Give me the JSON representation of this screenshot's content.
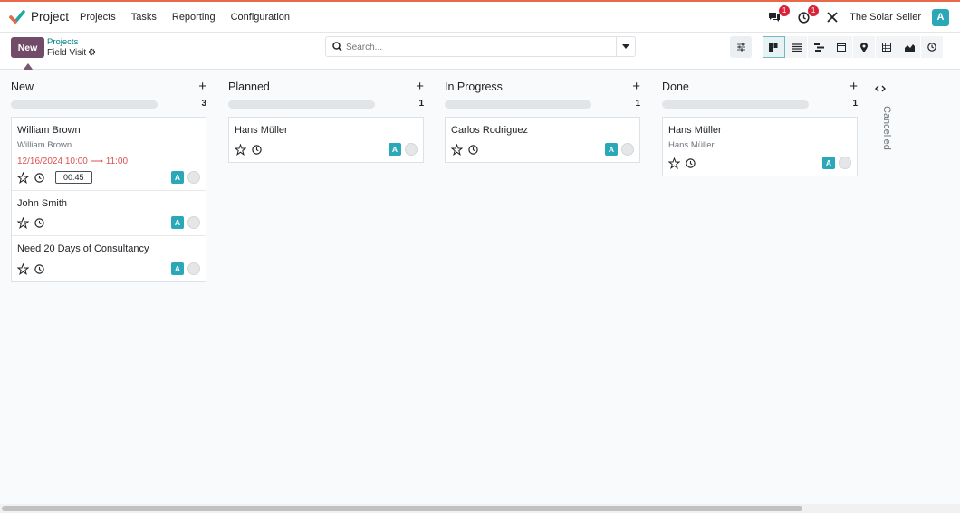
{
  "navbar": {
    "app_name": "Project",
    "menu": [
      "Projects",
      "Tasks",
      "Reporting",
      "Configuration"
    ],
    "messages_count": "1",
    "activities_count": "1",
    "company": "The Solar Seller",
    "user_initial": "A",
    "icons": [
      "messages-icon",
      "activity-clock-icon",
      "debug-tools-icon"
    ]
  },
  "control": {
    "new_label": "New",
    "breadcrumb_parent": "Projects",
    "breadcrumb_current": "Field Visit",
    "search_placeholder": "Search...",
    "views": [
      "kanban",
      "list",
      "gantt",
      "calendar",
      "map",
      "pivot",
      "graph",
      "activity"
    ],
    "active_view": "kanban"
  },
  "columns": [
    {
      "title": "New",
      "count": "3",
      "cards": [
        {
          "title": "William Brown",
          "subtitle": "William Brown",
          "date": "12/16/2024 10:00",
          "date_end": "11:00",
          "time": "00:45",
          "avatar": "A"
        },
        {
          "title": "John Smith",
          "avatar": "A"
        },
        {
          "title": "Need 20 Days of Consultancy",
          "avatar": "A"
        }
      ]
    },
    {
      "title": "Planned",
      "count": "1",
      "cards": [
        {
          "title": "Hans Müller",
          "avatar": "A"
        }
      ]
    },
    {
      "title": "In Progress",
      "count": "1",
      "cards": [
        {
          "title": "Carlos Rodriguez",
          "avatar": "A"
        }
      ]
    },
    {
      "title": "Done",
      "count": "1",
      "cards": [
        {
          "title": "Hans Müller",
          "subtitle": "Hans Müller",
          "avatar": "A"
        }
      ]
    }
  ],
  "folded_column": "Cancelled",
  "colors": {
    "primary": "#714b67",
    "accent": "#017e84",
    "avatar": "#2aa8b7",
    "overdue": "#d9534f"
  }
}
